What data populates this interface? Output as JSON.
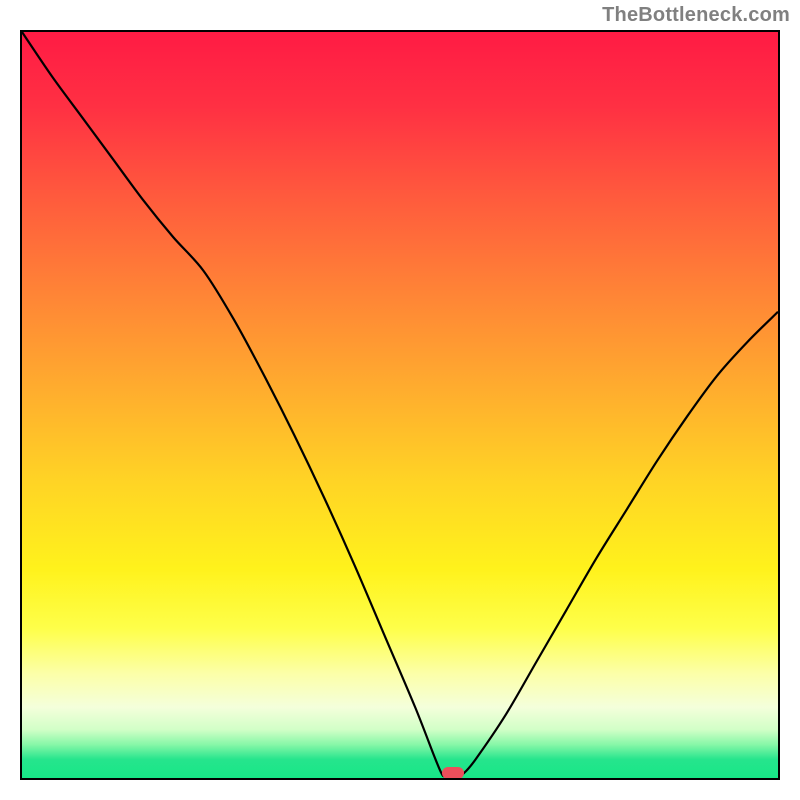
{
  "watermark": "TheBottleneck.com",
  "marker": {
    "color": "#ec4f5b"
  },
  "gradient_stops": [
    {
      "offset": 0.0,
      "color": "#ff1b44"
    },
    {
      "offset": 0.1,
      "color": "#ff3043"
    },
    {
      "offset": 0.22,
      "color": "#ff5a3d"
    },
    {
      "offset": 0.35,
      "color": "#ff8436"
    },
    {
      "offset": 0.48,
      "color": "#ffad2e"
    },
    {
      "offset": 0.6,
      "color": "#ffd325"
    },
    {
      "offset": 0.72,
      "color": "#fff21c"
    },
    {
      "offset": 0.8,
      "color": "#feff4a"
    },
    {
      "offset": 0.86,
      "color": "#fcffa8"
    },
    {
      "offset": 0.905,
      "color": "#f4ffdb"
    },
    {
      "offset": 0.935,
      "color": "#d2ffc7"
    },
    {
      "offset": 0.955,
      "color": "#88f7a8"
    },
    {
      "offset": 0.975,
      "color": "#26e58d"
    },
    {
      "offset": 1.0,
      "color": "#17e686"
    }
  ],
  "chart_data": {
    "type": "line",
    "title": "",
    "xlabel": "",
    "ylabel": "",
    "xlim": [
      0,
      100
    ],
    "ylim": [
      0,
      100
    ],
    "x": [
      0,
      4,
      8,
      12,
      16,
      20,
      24,
      28,
      32,
      36,
      40,
      44,
      48,
      52,
      54.5,
      55.5,
      56,
      57.5,
      58.5,
      60,
      64,
      68,
      72,
      76,
      80,
      84,
      88,
      92,
      96,
      100
    ],
    "y": [
      100,
      94,
      88.5,
      83,
      77.5,
      72.5,
      68,
      61.5,
      54,
      46,
      37.5,
      28.5,
      19,
      9.5,
      3.0,
      0.6,
      0.2,
      0.2,
      0.7,
      2.5,
      8.5,
      15.5,
      22.5,
      29.5,
      36,
      42.5,
      48.5,
      54,
      58.5,
      62.5
    ],
    "minimum": {
      "x": 57,
      "y": 0
    }
  }
}
